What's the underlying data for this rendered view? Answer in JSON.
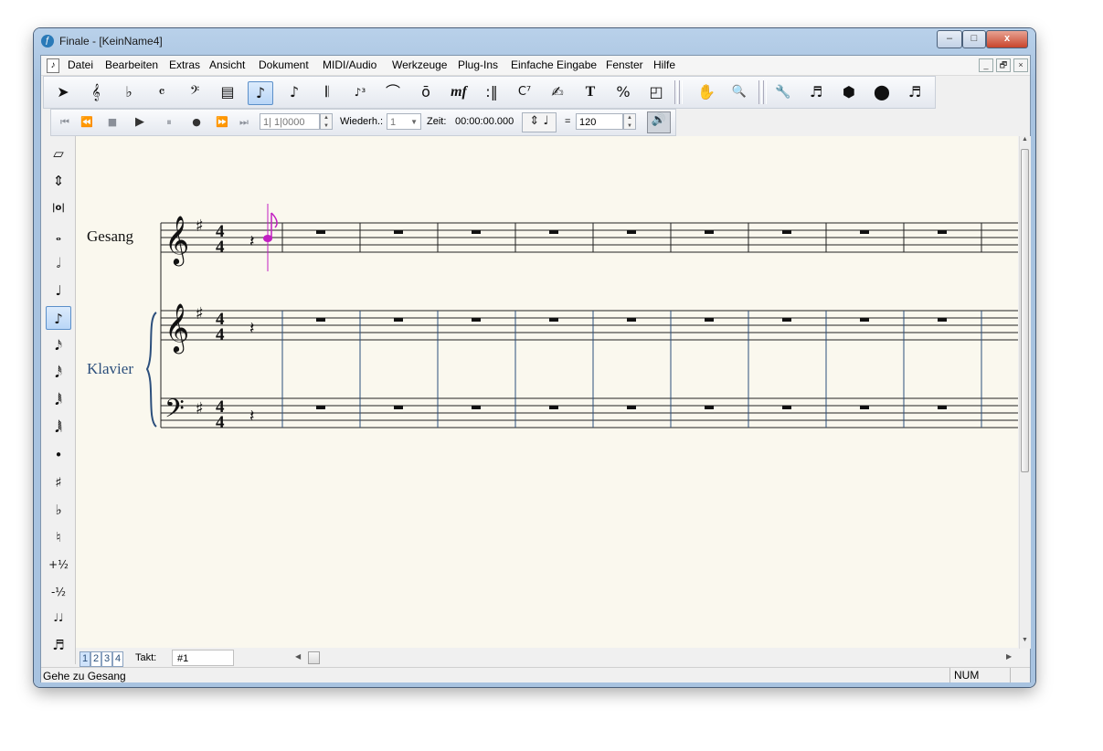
{
  "window": {
    "title": "Finale  - [KeinName4]",
    "minimize": "–",
    "maximize": "□",
    "close": "x"
  },
  "menubar": {
    "items": [
      "Datei",
      "Bearbeiten",
      "Extras",
      "Ansicht",
      "Dokument",
      "MIDI/Audio",
      "Werkzeuge",
      "Plug-Ins",
      "Einfache Eingabe",
      "Fenster",
      "Hilfe"
    ],
    "mdi_buttons": [
      "_",
      "🗗",
      "×"
    ]
  },
  "toolbar": {
    "tools": [
      {
        "name": "selection-tool",
        "glyph": "➤"
      },
      {
        "name": "staff-tool",
        "glyph": "𝄞"
      },
      {
        "name": "key-signature-tool",
        "glyph": "♭"
      },
      {
        "name": "time-signature-tool",
        "glyph": "𝄴"
      },
      {
        "name": "clef-tool",
        "glyph": "𝄢"
      },
      {
        "name": "measure-tool",
        "glyph": "▤"
      },
      {
        "name": "simple-entry-tool",
        "glyph": "♪"
      },
      {
        "name": "speedy-entry-tool",
        "glyph": "♪"
      },
      {
        "name": "hyperscribe-tool",
        "glyph": "𝄃"
      },
      {
        "name": "tuplet-tool",
        "glyph": "♪³"
      },
      {
        "name": "smart-shape-tool",
        "glyph": "⌒"
      },
      {
        "name": "articulation-tool",
        "glyph": "ō"
      },
      {
        "name": "expression-tool",
        "glyph": "mf"
      },
      {
        "name": "repeat-tool",
        "glyph": ":‖"
      },
      {
        "name": "chord-tool",
        "glyph": "C⁷"
      },
      {
        "name": "lyrics-tool",
        "glyph": "✍"
      },
      {
        "name": "text-tool",
        "glyph": "T"
      },
      {
        "name": "resize-tool",
        "glyph": "%"
      },
      {
        "name": "graphics-tool",
        "glyph": "◰"
      },
      {
        "name": "hand-grabber-tool",
        "glyph": "✋"
      },
      {
        "name": "zoom-tool",
        "glyph": "🔍"
      },
      {
        "name": "special-tools",
        "glyph": "🔧"
      },
      {
        "name": "mirror-tool",
        "glyph": "♬"
      },
      {
        "name": "note-mover-tool",
        "glyph": "⬢"
      },
      {
        "name": "midi-tool",
        "glyph": "⬤"
      },
      {
        "name": "ossia-tool",
        "glyph": "♬"
      }
    ]
  },
  "playback": {
    "buttons": [
      {
        "name": "rewind-start-icon",
        "glyph": "⏮"
      },
      {
        "name": "rewind-icon",
        "glyph": "⏪"
      },
      {
        "name": "stop-icon",
        "glyph": "■"
      },
      {
        "name": "play-icon",
        "glyph": "▶"
      },
      {
        "name": "pause-icon",
        "glyph": "⏸"
      },
      {
        "name": "record-icon",
        "glyph": "●"
      },
      {
        "name": "fast-forward-icon",
        "glyph": "⏩"
      },
      {
        "name": "forward-end-icon",
        "glyph": "⏭"
      }
    ],
    "counter": "1| 1|0000",
    "repeat_label": "Wiederh.:",
    "repeat_value": "1",
    "time_label": "Zeit:",
    "time_value": "00:00:00.000",
    "tempo_eq": "=",
    "tempo_value": "120"
  },
  "palette": {
    "items": [
      {
        "name": "eraser-icon",
        "glyph": "▱"
      },
      {
        "name": "tie-tool-icon",
        "glyph": "⇕"
      },
      {
        "name": "breve-icon",
        "glyph": "|o|"
      },
      {
        "name": "whole-note-icon",
        "glyph": "𝅝"
      },
      {
        "name": "half-note-icon",
        "glyph": "𝅗𝅥"
      },
      {
        "name": "quarter-note-icon",
        "glyph": "♩"
      },
      {
        "name": "eighth-note-icon",
        "glyph": "♪"
      },
      {
        "name": "sixteenth-note-icon",
        "glyph": "𝅘𝅥𝅯"
      },
      {
        "name": "thirty-second-note-icon",
        "glyph": "𝅘𝅥𝅰"
      },
      {
        "name": "sixty-fourth-note-icon",
        "glyph": "𝅘𝅥𝅱"
      },
      {
        "name": "128th-note-icon",
        "glyph": "𝅘𝅥𝅲"
      },
      {
        "name": "dot-icon",
        "glyph": "•"
      },
      {
        "name": "sharp-icon",
        "glyph": "♯"
      },
      {
        "name": "flat-icon",
        "glyph": "♭"
      },
      {
        "name": "natural-icon",
        "glyph": "♮"
      },
      {
        "name": "half-step-up-icon",
        "glyph": "+½"
      },
      {
        "name": "half-step-down-icon",
        "glyph": "-½"
      },
      {
        "name": "tie-icon",
        "glyph": "♩♩"
      },
      {
        "name": "tuplet-icon",
        "glyph": "♬"
      }
    ],
    "selected_index": 6
  },
  "score": {
    "staves": [
      {
        "label": "Gesang",
        "label_color": "#111111"
      },
      {
        "label": "Klavier",
        "label_color": "#2c4f7c"
      }
    ],
    "key_signature": "♯",
    "time_signature": [
      "4",
      "4"
    ],
    "cursor_color": "#c21fc2"
  },
  "bottombar": {
    "page_tabs": [
      "1",
      "2",
      "3",
      "4"
    ],
    "takt_label": "Takt:",
    "takt_value": "#1"
  },
  "statusbar": {
    "text": "Gehe zu Gesang",
    "num": "NUM"
  }
}
